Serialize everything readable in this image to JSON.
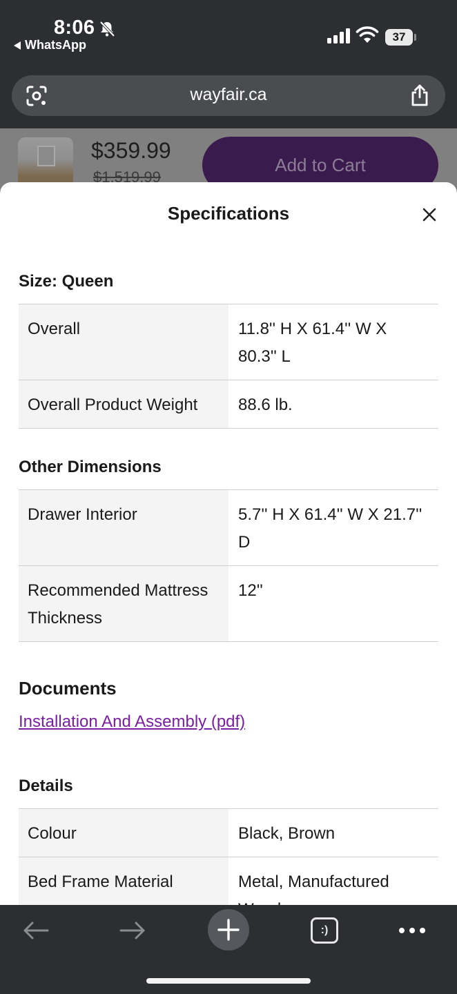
{
  "status_bar": {
    "time": "8:06",
    "back_app": "WhatsApp",
    "battery": "37"
  },
  "browser": {
    "url": "wayfair.ca"
  },
  "product_strip": {
    "price": "$359.99",
    "old_price": "$1,519.99",
    "add_to_cart": "Add to Cart"
  },
  "sheet": {
    "title": "Specifications",
    "size_heading": "Size: Queen",
    "size_rows": [
      {
        "k": "Overall",
        "v": "11.8'' H X 61.4'' W X 80.3'' L"
      },
      {
        "k": "Overall Product Weight",
        "v": "88.6 lb."
      }
    ],
    "other_heading": "Other Dimensions",
    "other_rows": [
      {
        "k": "Drawer Interior",
        "v": "5.7'' H X 61.4'' W X 21.7'' D"
      },
      {
        "k": "Recommended Mattress Thickness",
        "v": "12''"
      }
    ],
    "documents_heading": "Documents",
    "document_link": "Installation And Assembly (pdf)",
    "details_heading": "Details",
    "details_rows": [
      {
        "k": "Colour",
        "v": "Black, Brown"
      },
      {
        "k": "Bed Frame Material",
        "v": "Metal, Manufactured Wood"
      }
    ]
  },
  "toolbar": {
    "tabs_label": ":)"
  },
  "colors": {
    "brand_purple": "#7b1fa2",
    "cart_button_dimmed": "#3b1a4e",
    "chrome_dark": "#2c2e31"
  }
}
